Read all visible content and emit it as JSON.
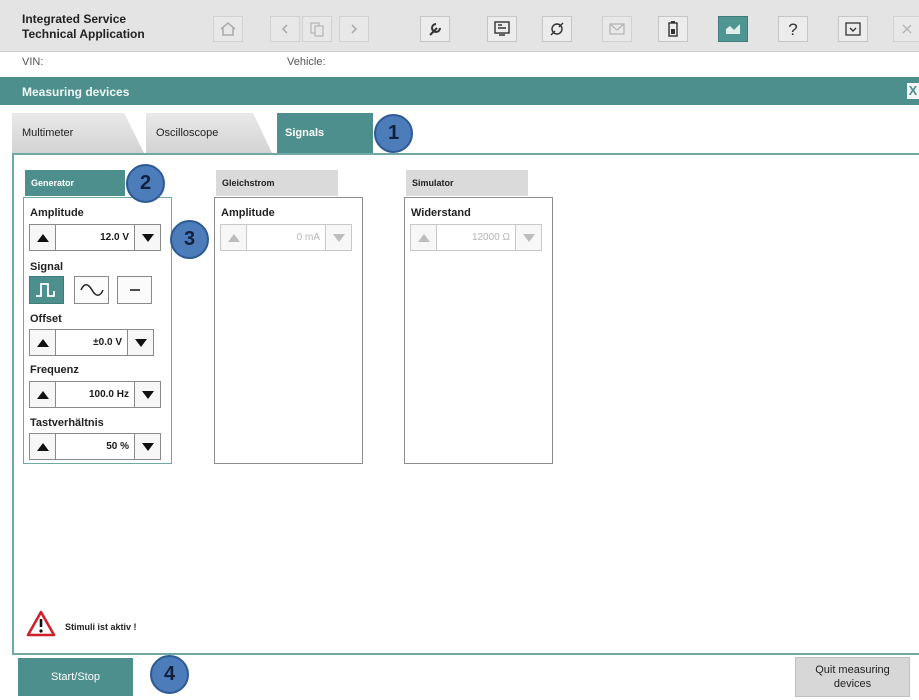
{
  "app": {
    "title_line1": "Integrated Service",
    "title_line2": "Technical Application"
  },
  "toolbar_icons": [
    "home-icon",
    "back-icon",
    "copy-icon",
    "forward-icon",
    "wrench-icon",
    "diagnostics-icon",
    "connection-icon",
    "mail-icon",
    "battery-icon",
    "measuring-icon",
    "help-icon",
    "print-icon",
    "close-icon"
  ],
  "vin_bar": {
    "vin_label": "VIN:",
    "vehicle_label": "Vehicle:"
  },
  "header": {
    "title": "Measuring devices",
    "close_label": "X"
  },
  "tabs": [
    {
      "label": "Multimeter"
    },
    {
      "label": "Oscilloscope"
    },
    {
      "label": "Signals"
    }
  ],
  "generator": {
    "header": "Generator",
    "amplitude": {
      "label": "Amplitude",
      "value": "12.0 V"
    },
    "signal": {
      "label": "Signal",
      "options": [
        "square-wave-icon",
        "sine-wave-icon",
        "dc-line-icon"
      ],
      "selected": "square-wave-icon"
    },
    "offset": {
      "label": "Offset",
      "value": "±0.0 V"
    },
    "frequency": {
      "label": "Frequenz",
      "value": "100.0 Hz"
    },
    "duty_cycle": {
      "label": "Tastverhältnis",
      "value": "50 %"
    }
  },
  "gleichstrom": {
    "header": "Gleichstrom",
    "amplitude": {
      "label": "Amplitude",
      "value": "0 mA"
    }
  },
  "simulator": {
    "header": "Simulator",
    "resistance": {
      "label": "Widerstand",
      "value": "12000 Ω"
    }
  },
  "callouts": [
    "1",
    "2",
    "3",
    "4"
  ],
  "status": {
    "text": "Stimuli ist aktiv !"
  },
  "buttons": {
    "start_stop": "Start/Stop",
    "quit_line1": "Quit measuring",
    "quit_line2": "devices"
  },
  "colors": {
    "accent": "#4d8f8c",
    "callout": "#4d7cbb",
    "warning": "#d0202a"
  }
}
